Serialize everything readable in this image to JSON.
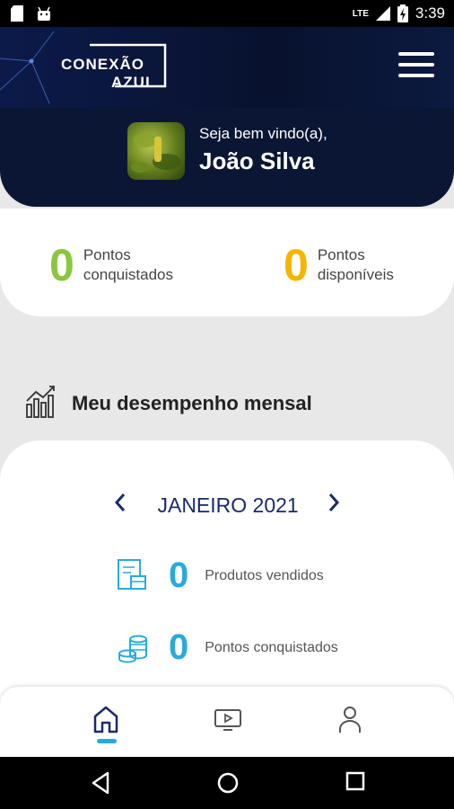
{
  "status_bar": {
    "time": "3:39",
    "network": "LTE"
  },
  "header": {
    "logo_line1": "CONEXÃO",
    "logo_line2": "AZUL",
    "welcome": "Seja bem vindo(a),",
    "user_name": "João Silva"
  },
  "points": {
    "earned_value": "0",
    "earned_label_1": "Pontos",
    "earned_label_2": "conquistados",
    "available_value": "0",
    "available_label_1": "Pontos",
    "available_label_2": "disponíveis",
    "earned_color": "#8cc63f",
    "available_color": "#f7b500"
  },
  "performance": {
    "title": "Meu desempenho mensal",
    "month": "JANEIRO 2021",
    "stats": [
      {
        "value": "0",
        "label": "Produtos vendidos",
        "icon": "product-list-icon"
      },
      {
        "value": "0",
        "label": "Pontos conquistados",
        "icon": "coins-stack-icon"
      }
    ]
  },
  "bottom_nav": {
    "items": [
      {
        "icon": "home-icon",
        "active": true
      },
      {
        "icon": "video-screen-icon",
        "active": false
      },
      {
        "icon": "profile-icon",
        "active": false
      }
    ]
  },
  "colors": {
    "accent": "#29aadf",
    "header_bg": "#0b1634",
    "month_text": "#1a2a6c"
  }
}
